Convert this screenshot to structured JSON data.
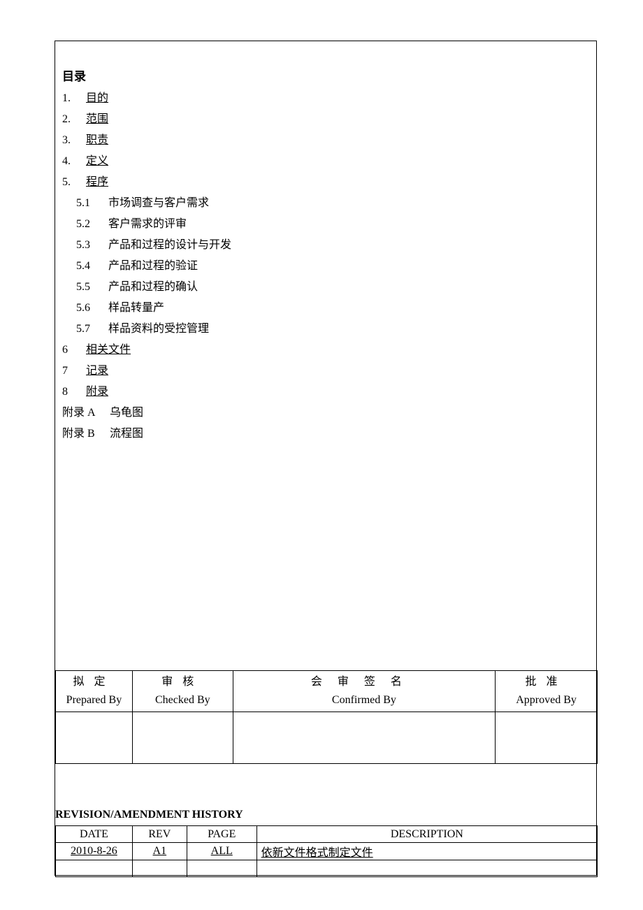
{
  "toc": {
    "title": "目录",
    "items": [
      {
        "num": "1.",
        "label": "目的",
        "link": true
      },
      {
        "num": "2.",
        "label": "范围",
        "link": true
      },
      {
        "num": "3.",
        "label": "职责",
        "link": true
      },
      {
        "num": "4.",
        "label": "定义",
        "link": true
      },
      {
        "num": "5.",
        "label": "程序",
        "link": true
      },
      {
        "num": "6",
        "label": "相关文件",
        "link": true
      },
      {
        "num": "7",
        "label": "记录",
        "link": true
      },
      {
        "num": "8",
        "label": "附录",
        "link": true
      }
    ],
    "sub5": [
      {
        "num": "5.1",
        "label": "市场调查与客户需求"
      },
      {
        "num": "5.2",
        "label": "客户需求的评审"
      },
      {
        "num": "5.3",
        "label": "产品和过程的设计与开发"
      },
      {
        "num": "5.4",
        "label": "产品和过程的验证"
      },
      {
        "num": "5.5",
        "label": "产品和过程的确认"
      },
      {
        "num": "5.6",
        "label": "样品转量产"
      },
      {
        "num": "5.7",
        "label": "样品资料的受控管理"
      }
    ],
    "appendix": [
      {
        "key": "附录 A",
        "label": "乌龟图"
      },
      {
        "key": "附录 B",
        "label": "流程图"
      }
    ]
  },
  "signoff": {
    "headers": [
      {
        "cn": "拟定",
        "en": "Prepared By"
      },
      {
        "cn": "审核",
        "en": "Checked By"
      },
      {
        "cn": "会审签名",
        "en": "Confirmed By"
      },
      {
        "cn": "批准",
        "en": "Approved By"
      }
    ]
  },
  "revision": {
    "title": "REVISION/AMENDMENT HISTORY",
    "headers": {
      "date": "DATE",
      "rev": "REV",
      "page": "PAGE",
      "desc": "DESCRIPTION"
    },
    "rows": [
      {
        "date": "2010-8-26",
        "rev": "A1",
        "page": "ALL",
        "desc": "依新文件格式制定文件"
      },
      {
        "date": "",
        "rev": "",
        "page": "",
        "desc": ""
      }
    ]
  }
}
